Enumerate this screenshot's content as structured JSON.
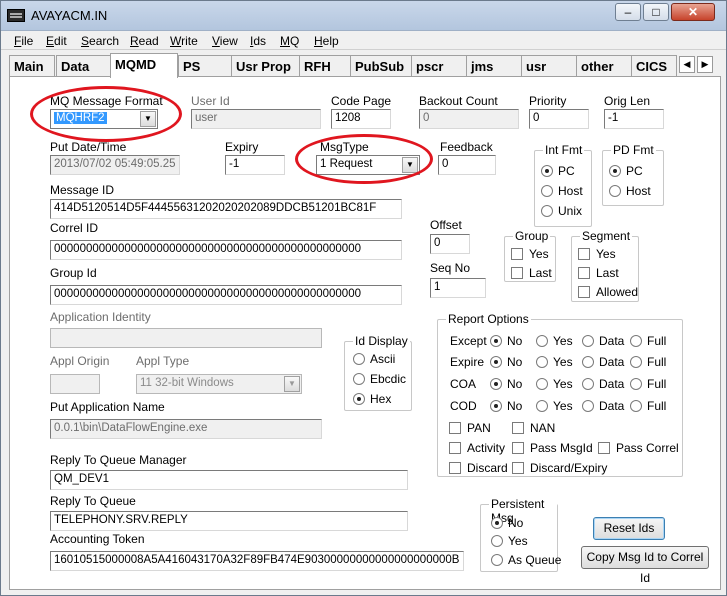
{
  "window": {
    "title": "AVAYACM.IN",
    "minimize": "–",
    "maximize": "□",
    "close": "✕"
  },
  "menu": [
    "File",
    "Edit",
    "Search",
    "Read",
    "Write",
    "View",
    "Ids",
    "MQ",
    "Help"
  ],
  "tabs": [
    "Main",
    "Data",
    "MQMD",
    "PS",
    "Usr Prop",
    "RFH",
    "PubSub",
    "pscr",
    "jms",
    "usr",
    "other",
    "CICS"
  ],
  "active_tab": "MQMD",
  "tab_scroll": {
    "left": "◀",
    "right": "▶"
  },
  "fields": {
    "mq_message_format": {
      "label": "MQ Message Format",
      "value": "MQHRF2"
    },
    "user_id": {
      "label": "User Id",
      "value": "user"
    },
    "code_page": {
      "label": "Code Page",
      "value": "1208"
    },
    "backout_count": {
      "label": "Backout Count",
      "value": "0"
    },
    "priority": {
      "label": "Priority",
      "value": "0"
    },
    "orig_len": {
      "label": "Orig Len",
      "value": "-1"
    },
    "put_date_time": {
      "label": "Put Date/Time",
      "value": "2013/07/02 05:49:05.25"
    },
    "expiry": {
      "label": "Expiry",
      "value": "-1"
    },
    "msg_type": {
      "label": "MsgType",
      "value": "1 Request"
    },
    "feedback": {
      "label": "Feedback",
      "value": "0"
    },
    "message_id": {
      "label": "Message ID",
      "value": "414D5120514D5F44455631202020202089DDCB51201BC81F"
    },
    "correl_id": {
      "label": "Correl ID",
      "value": "000000000000000000000000000000000000000000000000"
    },
    "offset": {
      "label": "Offset",
      "value": "0"
    },
    "group_id": {
      "label": "Group Id",
      "value": "000000000000000000000000000000000000000000000000"
    },
    "seq_no": {
      "label": "Seq No",
      "value": "1"
    },
    "application_identity": {
      "label": "Application Identity",
      "value": ""
    },
    "appl_origin": {
      "label": "Appl Origin",
      "value": ""
    },
    "appl_type": {
      "label": "Appl Type",
      "value": "11 32-bit Windows"
    },
    "put_application_name": {
      "label": "Put Application Name",
      "value": "0.0.1\\bin\\DataFlowEngine.exe"
    },
    "reply_to_queue_manager": {
      "label": "Reply To Queue Manager",
      "value": "QM_DEV1"
    },
    "reply_to_queue": {
      "label": "Reply To Queue",
      "value": "TELEPHONY.SRV.REPLY"
    },
    "accounting_token": {
      "label": "Accounting Token",
      "value": "16010515000008A5A416043170A32F89FB474E90300000000000000000000B"
    }
  },
  "int_fmt": {
    "title": "Int Fmt",
    "options": [
      "PC",
      "Host",
      "Unix"
    ],
    "selected": "PC"
  },
  "pd_fmt": {
    "title": "PD Fmt",
    "options": [
      "PC",
      "Host"
    ],
    "selected": "PC"
  },
  "group_box": {
    "title": "Group",
    "options": [
      "Yes",
      "Last"
    ]
  },
  "segment_box": {
    "title": "Segment",
    "options": [
      "Yes",
      "Last",
      "Allowed"
    ]
  },
  "id_display": {
    "title": "Id Display",
    "options": [
      "Ascii",
      "Ebcdic",
      "Hex"
    ],
    "selected": "Hex"
  },
  "report_options": {
    "title": "Report Options",
    "rows": [
      {
        "label": "Except",
        "options": [
          "No",
          "Yes",
          "Data",
          "Full"
        ],
        "selected": "No"
      },
      {
        "label": "Expire",
        "options": [
          "No",
          "Yes",
          "Data",
          "Full"
        ],
        "selected": "No"
      },
      {
        "label": "COA",
        "options": [
          "No",
          "Yes",
          "Data",
          "Full"
        ],
        "selected": "No"
      },
      {
        "label": "COD",
        "options": [
          "No",
          "Yes",
          "Data",
          "Full"
        ],
        "selected": "No"
      }
    ],
    "checks": [
      "PAN",
      "NAN",
      "Activity",
      "Pass MsgId",
      "Pass Correl",
      "Discard",
      "Discard/Expiry"
    ]
  },
  "persistent_msg": {
    "title": "Persistent Msg",
    "options": [
      "No",
      "Yes",
      "As Queue"
    ],
    "selected": "No"
  },
  "buttons": {
    "reset_ids": "Reset Ids",
    "copy_msg_id": "Copy Msg Id to Correl Id"
  },
  "colors": {
    "annotation_ring": "#e0161f",
    "selection": "#3399ff"
  }
}
